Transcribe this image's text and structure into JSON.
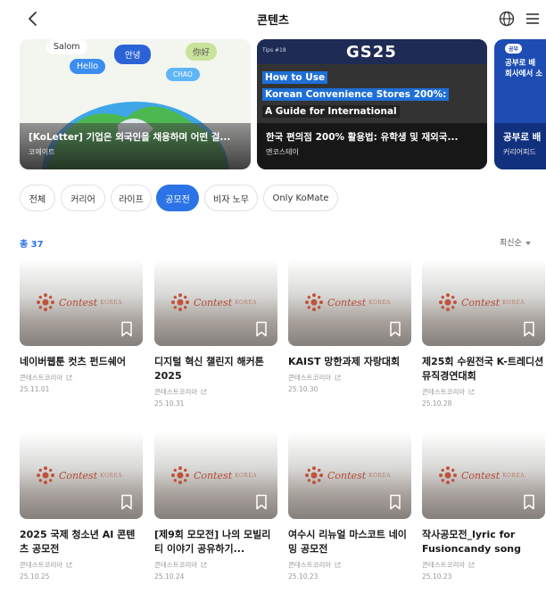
{
  "header": {
    "title": "콘텐츠"
  },
  "banners": [
    {
      "title": "[KoLetter] 기업은 외국인을 채용하며 어떤 걸...",
      "source": "코메이트",
      "bubbles": [
        "Salom",
        "안녕",
        "你好",
        "Hello",
        "CHAO"
      ]
    },
    {
      "title": "한국 편의점 200% 활용법: 유학생 및 재외국...",
      "source": "엔코스테이",
      "brand": "GS25",
      "tag": "Tips #18",
      "lines": [
        "How to Use",
        "Korean Convenience Stores 200%:",
        "A Guide for International"
      ]
    },
    {
      "title": "공부로 배",
      "source": "커리어피드",
      "tag": "공부",
      "lines": [
        "공부로 배",
        "회사에서 소"
      ]
    }
  ],
  "chips": [
    "전체",
    "커리어",
    "라이프",
    "공모전",
    "비자 노무",
    "Only KoMate"
  ],
  "active_chip": "공모전",
  "list": {
    "count": "총 37",
    "sort": "최신순"
  },
  "thumb_logo": {
    "text": "Contest",
    "sub": "KOREA"
  },
  "cards": [
    {
      "title": "네이버웹툰 컷츠 펀드쉐어",
      "source": "콘테스트코리아",
      "date": "25.11.01"
    },
    {
      "title": "디지털 혁신 챌린지 해커톤 2025",
      "source": "콘테스트코리아",
      "date": "25.10.31"
    },
    {
      "title": "KAIST 망한과제 자랑대회",
      "source": "콘테스트코리아",
      "date": "25.10.30"
    },
    {
      "title": "제25회 수원전국 K-트레디션 뮤직경연대회",
      "source": "콘테스트코리아",
      "date": "25.10.28"
    },
    {
      "title": "2025 국제 청소년 AI 콘텐츠 공모전",
      "source": "콘테스트코리아",
      "date": "25.10.25"
    },
    {
      "title": "[제9회 모모전] 나의 모빌리티 이야기 공유하기...",
      "source": "콘테스트코리아",
      "date": "25.10.24"
    },
    {
      "title": "여수시 리뉴얼 마스코트 네이밍 공모전",
      "source": "콘테스트코리아",
      "date": "25.10.23"
    },
    {
      "title": "작사공모전_lyric for Fusioncandy song",
      "source": "콘테스트코리아",
      "date": "25.10.23"
    }
  ],
  "colors": {
    "accent": "#2b73e6",
    "logo": "#b44b36"
  }
}
